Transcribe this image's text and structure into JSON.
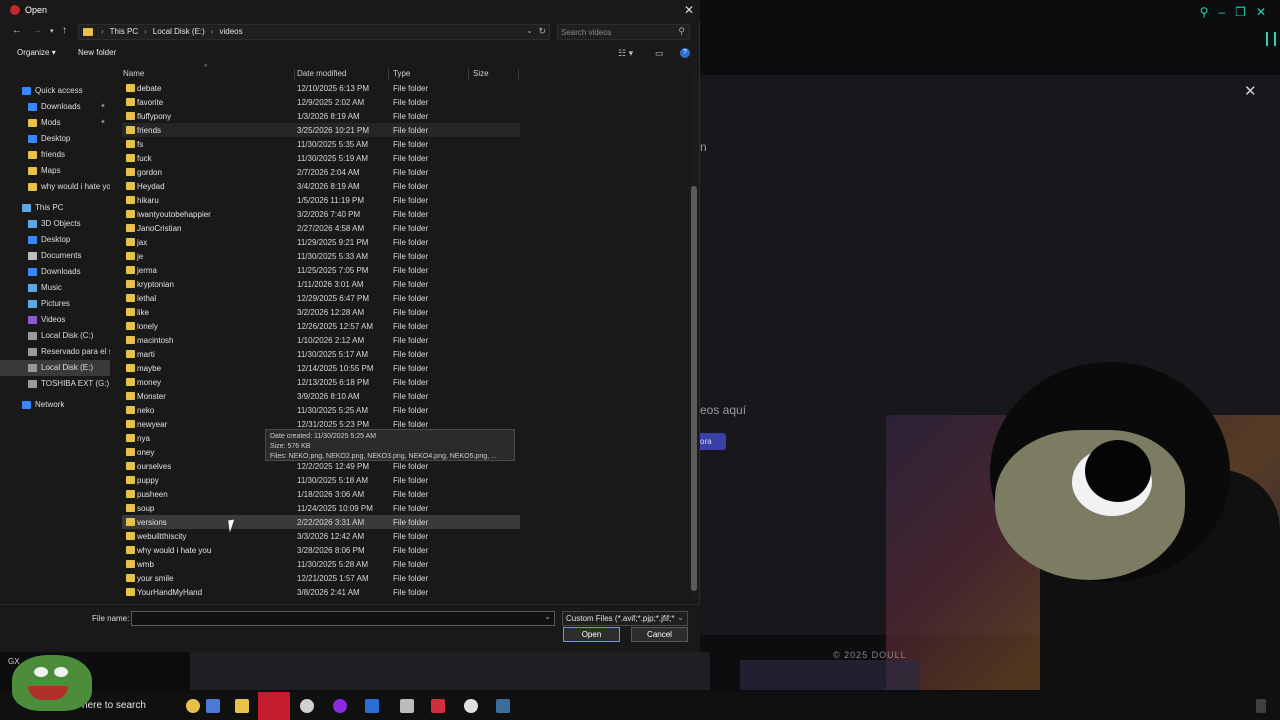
{
  "dialog": {
    "title": "Open",
    "breadcrumb": [
      "This PC",
      "Local Disk (E:)",
      "videos"
    ],
    "search_placeholder": "Search videos",
    "toolbar": {
      "organize": "Organize",
      "new_folder": "New folder"
    }
  },
  "navpane": {
    "items": [
      {
        "label": "Quick access",
        "icon": "star-icon",
        "color": "#3a86ff",
        "indent": 1,
        "pinned": false
      },
      {
        "label": "Downloads",
        "icon": "download-icon",
        "color": "#3a86ff",
        "indent": 2,
        "pinned": true
      },
      {
        "label": "Mods",
        "icon": "folder-icon",
        "color": "#e8c14a",
        "indent": 2,
        "pinned": true
      },
      {
        "label": "Desktop",
        "icon": "desktop-icon",
        "color": "#3a86ff",
        "indent": 2,
        "pinned": false
      },
      {
        "label": "friends",
        "icon": "folder-icon",
        "color": "#e8c14a",
        "indent": 2,
        "pinned": false
      },
      {
        "label": "Maps",
        "icon": "folder-icon",
        "color": "#e8c14a",
        "indent": 2,
        "pinned": false
      },
      {
        "label": "why would i hate yo",
        "icon": "folder-icon",
        "color": "#e8c14a",
        "indent": 2,
        "pinned": false
      },
      {
        "label": "This PC",
        "icon": "pc-icon",
        "color": "#5aa9e6",
        "indent": 1,
        "pinned": false
      },
      {
        "label": "3D Objects",
        "icon": "cube-icon",
        "color": "#5aa9e6",
        "indent": 2,
        "pinned": false
      },
      {
        "label": "Desktop",
        "icon": "desktop-icon",
        "color": "#3a86ff",
        "indent": 2,
        "pinned": false
      },
      {
        "label": "Documents",
        "icon": "document-icon",
        "color": "#bfbfbf",
        "indent": 2,
        "pinned": false
      },
      {
        "label": "Downloads",
        "icon": "download-icon",
        "color": "#3a86ff",
        "indent": 2,
        "pinned": false
      },
      {
        "label": "Music",
        "icon": "music-icon",
        "color": "#5aa9e6",
        "indent": 2,
        "pinned": false
      },
      {
        "label": "Pictures",
        "icon": "picture-icon",
        "color": "#5aa9e6",
        "indent": 2,
        "pinned": false
      },
      {
        "label": "Videos",
        "icon": "video-icon",
        "color": "#8a5ad6",
        "indent": 2,
        "pinned": false
      },
      {
        "label": "Local Disk (C:)",
        "icon": "drive-icon",
        "color": "#9a9a9a",
        "indent": 2,
        "pinned": false
      },
      {
        "label": "Reservado para el si",
        "icon": "drive-icon",
        "color": "#9a9a9a",
        "indent": 2,
        "pinned": false
      },
      {
        "label": "Local Disk (E:)",
        "icon": "drive-icon",
        "color": "#9a9a9a",
        "indent": 2,
        "pinned": false,
        "selected": true
      },
      {
        "label": "TOSHIBA EXT (G:)",
        "icon": "drive-icon",
        "color": "#9a9a9a",
        "indent": 2,
        "pinned": false
      },
      {
        "label": "Network",
        "icon": "network-icon",
        "color": "#3a86ff",
        "indent": 1,
        "pinned": false
      }
    ]
  },
  "columns": {
    "name": "Name",
    "date": "Date modified",
    "type": "Type",
    "size": "Size"
  },
  "files": [
    {
      "name": "debate",
      "date": "12/10/2025 6:13 PM",
      "type": "File folder"
    },
    {
      "name": "favorite",
      "date": "12/9/2025 2:02 AM",
      "type": "File folder"
    },
    {
      "name": "fluffypony",
      "date": "1/3/2026 8:19 AM",
      "type": "File folder"
    },
    {
      "name": "friends",
      "date": "3/25/2026 10:21 PM",
      "type": "File folder",
      "hl": "hl2"
    },
    {
      "name": "fs",
      "date": "11/30/2025 5:35 AM",
      "type": "File folder"
    },
    {
      "name": "fuck",
      "date": "11/30/2025 5:19 AM",
      "type": "File folder"
    },
    {
      "name": "gordon",
      "date": "2/7/2026 2:04 AM",
      "type": "File folder"
    },
    {
      "name": "Heydad",
      "date": "3/4/2026 8:19 AM",
      "type": "File folder"
    },
    {
      "name": "hikaru",
      "date": "1/5/2026 11:19 PM",
      "type": "File folder"
    },
    {
      "name": "iwantyoutobehappier",
      "date": "3/2/2026 7:40 PM",
      "type": "File folder"
    },
    {
      "name": "JanoCristian",
      "date": "2/27/2026 4:58 AM",
      "type": "File folder"
    },
    {
      "name": "jax",
      "date": "11/29/2025 9:21 PM",
      "type": "File folder"
    },
    {
      "name": "je",
      "date": "11/30/2025 5:33 AM",
      "type": "File folder"
    },
    {
      "name": "jerma",
      "date": "11/25/2025 7:05 PM",
      "type": "File folder"
    },
    {
      "name": "kryptonian",
      "date": "1/11/2026 3:01 AM",
      "type": "File folder"
    },
    {
      "name": "lethal",
      "date": "12/29/2025 6:47 PM",
      "type": "File folder"
    },
    {
      "name": "like",
      "date": "3/2/2026 12:28 AM",
      "type": "File folder"
    },
    {
      "name": "lonely",
      "date": "12/26/2025 12:57 AM",
      "type": "File folder"
    },
    {
      "name": "macintosh",
      "date": "1/10/2026 2:12 AM",
      "type": "File folder"
    },
    {
      "name": "marti",
      "date": "11/30/2025 5:17 AM",
      "type": "File folder"
    },
    {
      "name": "maybe",
      "date": "12/14/2025 10:55 PM",
      "type": "File folder"
    },
    {
      "name": "money",
      "date": "12/13/2025 6:18 PM",
      "type": "File folder"
    },
    {
      "name": "Monster",
      "date": "3/9/2026 8:10 AM",
      "type": "File folder"
    },
    {
      "name": "neko",
      "date": "11/30/2025 5:25 AM",
      "type": "File folder"
    },
    {
      "name": "newyear",
      "date": "12/31/2025 5:23 PM",
      "type": "File folder"
    },
    {
      "name": "nya",
      "date": "",
      "type": "File folder"
    },
    {
      "name": "oney",
      "date": "",
      "type": ""
    },
    {
      "name": "ourselves",
      "date": "12/2/2025 12:49 PM",
      "type": "File folder"
    },
    {
      "name": "puppy",
      "date": "11/30/2025 5:18 AM",
      "type": "File folder"
    },
    {
      "name": "pusheen",
      "date": "1/18/2026 3:06 AM",
      "type": "File folder"
    },
    {
      "name": "soup",
      "date": "11/24/2025 10:09 PM",
      "type": "File folder"
    },
    {
      "name": "versions",
      "date": "2/22/2026 3:31 AM",
      "type": "File folder",
      "hl": "hl"
    },
    {
      "name": "webuiltthiscity",
      "date": "3/3/2026 12:42 AM",
      "type": "File folder"
    },
    {
      "name": "why would i hate you",
      "date": "3/28/2026 8:06 PM",
      "type": "File folder"
    },
    {
      "name": "wmb",
      "date": "11/30/2025 5:28 AM",
      "type": "File folder"
    },
    {
      "name": "your smile",
      "date": "12/21/2025 1:57 AM",
      "type": "File folder"
    },
    {
      "name": "YourHandMyHand",
      "date": "3/8/2026 2:41 AM",
      "type": "File folder"
    }
  ],
  "tooltip": {
    "line1": "Date created: 11/30/2025 5:25 AM",
    "line2": "Size: 576 KB",
    "line3": "Files: NEKO.png, NEKO2.png, NEKO3.png, NEKO4.png, NEKO5.png, ..."
  },
  "bottom": {
    "file_name_label": "File name:",
    "file_name_value": "",
    "type_filter": "Custom Files (*.avif;*.pjp;*.jfif;*",
    "open": "Open",
    "cancel": "Cancel"
  },
  "background": {
    "text_partial_1": "n",
    "text_partial_2": "eos aquí",
    "button_partial": "ora",
    "watermark": "© 2025 DOULL"
  },
  "taskbar": {
    "search": "here to search",
    "gx": "GX"
  }
}
